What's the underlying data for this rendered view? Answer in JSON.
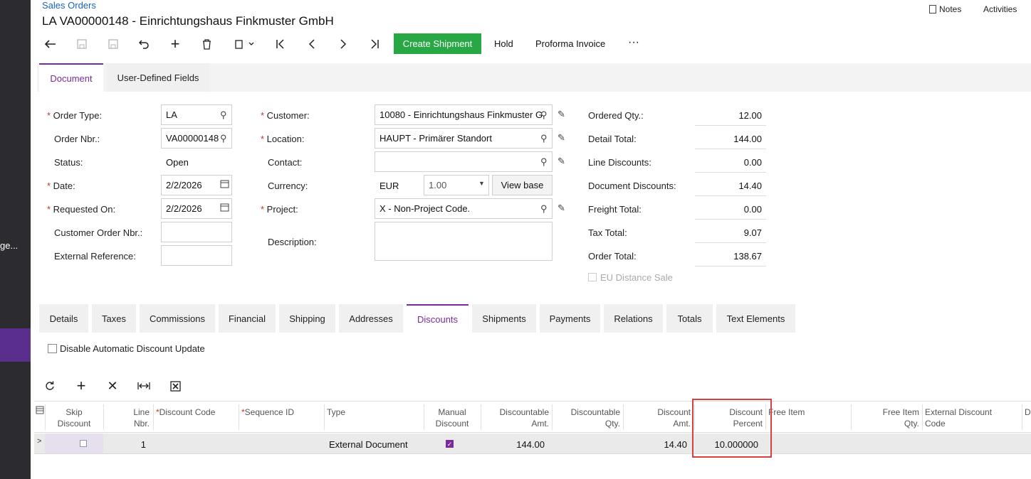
{
  "leftbar": {
    "truncated_label": "ge..."
  },
  "header": {
    "breadcrumb": "Sales Orders",
    "title": "LA VA00000148 - Einrichtungshaus Finkmuster GmbH",
    "notes": "Notes",
    "activities": "Activities"
  },
  "toolbar": {
    "create_shipment": "Create Shipment",
    "hold": "Hold",
    "proforma_invoice": "Proforma Invoice",
    "more": "···"
  },
  "form_tabs": [
    "Document",
    "User-Defined Fields"
  ],
  "form": {
    "order_type_label": "Order Type:",
    "order_type": "LA",
    "order_nbr_label": "Order Nbr.:",
    "order_nbr": "VA00000148",
    "status_label": "Status:",
    "status": "Open",
    "date_label": "Date:",
    "date": "2/2/2026",
    "requested_on_label": "Requested On:",
    "requested_on": "2/2/2026",
    "customer_order_nbr_label": "Customer Order Nbr.:",
    "external_reference_label": "External Reference:",
    "customer_label": "Customer:",
    "customer": "10080 - Einrichtungshaus Finkmuster G",
    "location_label": "Location:",
    "location": "HAUPT - Primärer Standort",
    "contact_label": "Contact:",
    "currency_label": "Currency:",
    "currency": "EUR",
    "rate": "1.00",
    "view_base": "View base",
    "project_label": "Project:",
    "project": "X - Non-Project Code.",
    "description_label": "Description:"
  },
  "totals": {
    "ordered_qty_label": "Ordered Qty.:",
    "ordered_qty": "12.00",
    "detail_total_label": "Detail Total:",
    "detail_total": "144.00",
    "line_discounts_label": "Line Discounts:",
    "line_discounts": "0.00",
    "document_discounts_label": "Document Discounts:",
    "document_discounts": "14.40",
    "freight_total_label": "Freight Total:",
    "freight_total": "0.00",
    "tax_total_label": "Tax Total:",
    "tax_total": "9.07",
    "order_total_label": "Order Total:",
    "order_total": "138.67",
    "eu_distance_sale": "EU Distance Sale"
  },
  "lower_tabs": [
    "Details",
    "Taxes",
    "Commissions",
    "Financial",
    "Shipping",
    "Addresses",
    "Discounts",
    "Shipments",
    "Payments",
    "Relations",
    "Totals",
    "Text Elements"
  ],
  "discounts": {
    "disable_auto_update": "Disable Automatic Discount Update",
    "headers": {
      "skip_discount_1": "Skip",
      "skip_discount_2": "Discount",
      "line_nbr_1": "Line",
      "line_nbr_2": "Nbr.",
      "discount_code": "Discount Code",
      "sequence_id": "Sequence ID",
      "type": "Type",
      "manual_1": "Manual",
      "manual_2": "Discount",
      "disc_amt_1": "Discountable",
      "disc_amt_2": "Amt.",
      "disc_qty_1": "Discountable",
      "disc_qty_2": "Qty.",
      "discount_amt_1": "Discount",
      "discount_amt_2": "Amt.",
      "discount_pct_1": "Discount",
      "discount_pct_2": "Percent",
      "free_item": "Free Item",
      "free_item_qty_1": "Free Item",
      "free_item_qty_2": "Qty.",
      "ext_code_1": "External Discount",
      "ext_code_2": "Code",
      "cut": "D"
    },
    "row": {
      "line_nbr": "1",
      "type": "External Document",
      "manual": true,
      "discountable_amt": "144.00",
      "discount_amt": "14.40",
      "discount_percent": "10.000000"
    }
  }
}
